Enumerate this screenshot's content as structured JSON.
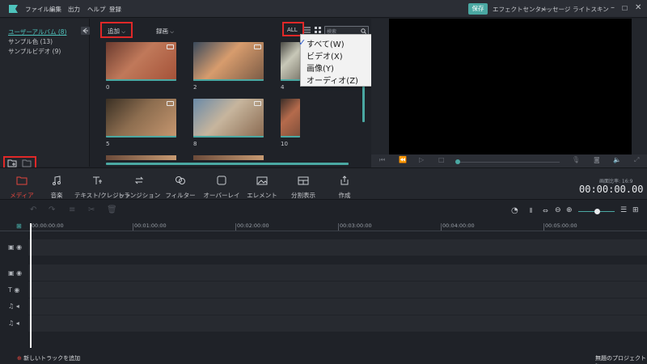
{
  "menubar": {
    "items": [
      "ファイル",
      "編集",
      "出力",
      "ヘルプ",
      "登録"
    ],
    "modes": {
      "active": "保存",
      "others": [
        "エフェクトセンター",
        "メッセージ",
        "ライトスキン"
      ]
    }
  },
  "albums": [
    {
      "label": "ユーザーアルバム (8)",
      "active": true
    },
    {
      "label": "サンプル色 (13)",
      "active": false
    },
    {
      "label": "サンプルビデオ (9)",
      "active": false
    }
  ],
  "library": {
    "add_label": "追加",
    "record_label": "録画",
    "all_label": "ALL",
    "search_placeholder": "検索",
    "thumbs": [
      {
        "label": "0",
        "colors": [
          "#6b3b2f",
          "#c0795a",
          "#a45138"
        ]
      },
      {
        "label": "2",
        "colors": [
          "#3a4a5c",
          "#d79c6d",
          "#7a5a45"
        ]
      },
      {
        "label": "4",
        "colors": [
          "#4a4a44",
          "#c8c8b8",
          "#7e7a6e"
        ]
      },
      {
        "label": "5",
        "colors": [
          "#3a3024",
          "#8c6d4f",
          "#c79770"
        ]
      },
      {
        "label": "8",
        "colors": [
          "#6a8aa8",
          "#c7b59d",
          "#8a6a50"
        ]
      },
      {
        "label": "10",
        "colors": [
          "#3c2e28",
          "#b56b4c",
          "#7d4e3a"
        ]
      }
    ]
  },
  "filter_menu": {
    "options": [
      {
        "label": "すべて(W)",
        "checked": true
      },
      {
        "label": "ビデオ(X)",
        "checked": false
      },
      {
        "label": "画像(Y)",
        "checked": false
      },
      {
        "label": "オーディオ(Z)",
        "checked": false
      }
    ]
  },
  "tabs": [
    {
      "label": "メディア",
      "icon": "folder-icon",
      "active": true
    },
    {
      "label": "音楽",
      "icon": "music-note-icon",
      "active": false
    },
    {
      "label": "テキスト/クレジット",
      "icon": "text-icon",
      "active": false
    },
    {
      "label": "トランジション",
      "icon": "transition-icon",
      "active": false
    },
    {
      "label": "フィルター",
      "icon": "filter-icon",
      "active": false
    },
    {
      "label": "オーバーレイ",
      "icon": "overlay-icon",
      "active": false
    },
    {
      "label": "エレメント",
      "icon": "image-icon",
      "active": false
    },
    {
      "label": "分割表示",
      "icon": "split-screen-icon",
      "active": false
    },
    {
      "label": "作成",
      "icon": "export-icon",
      "active": false
    }
  ],
  "aspect_label": "画面比率: 16:9",
  "timecode": "00:00:00.00",
  "ruler": [
    "00:00:00:00",
    "00:01:00:00",
    "00:02:00:00",
    "00:03:00:00",
    "00:04:00:00",
    "00:05:00:00"
  ],
  "footer": {
    "add_track": "新しいトラックを追加",
    "project": "無題のプロジェクト*"
  },
  "colors": {
    "accent": "#4aa8a2",
    "highlight_red": "#e02828",
    "active_tab_red": "#e2463d"
  }
}
